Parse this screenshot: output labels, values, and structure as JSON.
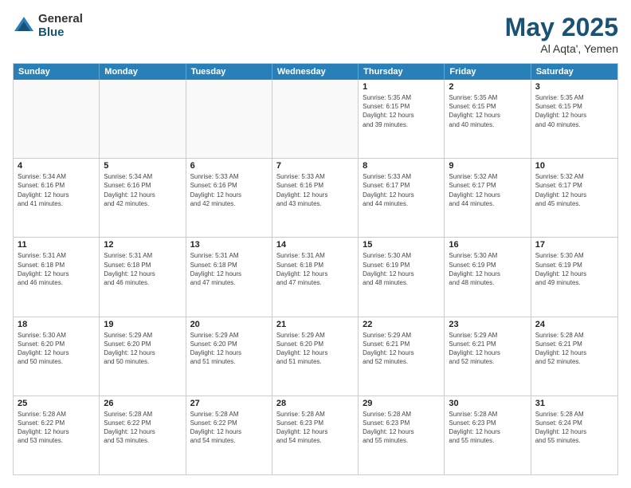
{
  "logo": {
    "general": "General",
    "blue": "Blue"
  },
  "title": {
    "month_year": "May 2025",
    "location": "Al Aqta', Yemen"
  },
  "days_of_week": [
    "Sunday",
    "Monday",
    "Tuesday",
    "Wednesday",
    "Thursday",
    "Friday",
    "Saturday"
  ],
  "weeks": [
    [
      {
        "day": "",
        "info": ""
      },
      {
        "day": "",
        "info": ""
      },
      {
        "day": "",
        "info": ""
      },
      {
        "day": "",
        "info": ""
      },
      {
        "day": "1",
        "info": "Sunrise: 5:35 AM\nSunset: 6:15 PM\nDaylight: 12 hours\nand 39 minutes."
      },
      {
        "day": "2",
        "info": "Sunrise: 5:35 AM\nSunset: 6:15 PM\nDaylight: 12 hours\nand 40 minutes."
      },
      {
        "day": "3",
        "info": "Sunrise: 5:35 AM\nSunset: 6:15 PM\nDaylight: 12 hours\nand 40 minutes."
      }
    ],
    [
      {
        "day": "4",
        "info": "Sunrise: 5:34 AM\nSunset: 6:16 PM\nDaylight: 12 hours\nand 41 minutes."
      },
      {
        "day": "5",
        "info": "Sunrise: 5:34 AM\nSunset: 6:16 PM\nDaylight: 12 hours\nand 42 minutes."
      },
      {
        "day": "6",
        "info": "Sunrise: 5:33 AM\nSunset: 6:16 PM\nDaylight: 12 hours\nand 42 minutes."
      },
      {
        "day": "7",
        "info": "Sunrise: 5:33 AM\nSunset: 6:16 PM\nDaylight: 12 hours\nand 43 minutes."
      },
      {
        "day": "8",
        "info": "Sunrise: 5:33 AM\nSunset: 6:17 PM\nDaylight: 12 hours\nand 44 minutes."
      },
      {
        "day": "9",
        "info": "Sunrise: 5:32 AM\nSunset: 6:17 PM\nDaylight: 12 hours\nand 44 minutes."
      },
      {
        "day": "10",
        "info": "Sunrise: 5:32 AM\nSunset: 6:17 PM\nDaylight: 12 hours\nand 45 minutes."
      }
    ],
    [
      {
        "day": "11",
        "info": "Sunrise: 5:31 AM\nSunset: 6:18 PM\nDaylight: 12 hours\nand 46 minutes."
      },
      {
        "day": "12",
        "info": "Sunrise: 5:31 AM\nSunset: 6:18 PM\nDaylight: 12 hours\nand 46 minutes."
      },
      {
        "day": "13",
        "info": "Sunrise: 5:31 AM\nSunset: 6:18 PM\nDaylight: 12 hours\nand 47 minutes."
      },
      {
        "day": "14",
        "info": "Sunrise: 5:31 AM\nSunset: 6:18 PM\nDaylight: 12 hours\nand 47 minutes."
      },
      {
        "day": "15",
        "info": "Sunrise: 5:30 AM\nSunset: 6:19 PM\nDaylight: 12 hours\nand 48 minutes."
      },
      {
        "day": "16",
        "info": "Sunrise: 5:30 AM\nSunset: 6:19 PM\nDaylight: 12 hours\nand 48 minutes."
      },
      {
        "day": "17",
        "info": "Sunrise: 5:30 AM\nSunset: 6:19 PM\nDaylight: 12 hours\nand 49 minutes."
      }
    ],
    [
      {
        "day": "18",
        "info": "Sunrise: 5:30 AM\nSunset: 6:20 PM\nDaylight: 12 hours\nand 50 minutes."
      },
      {
        "day": "19",
        "info": "Sunrise: 5:29 AM\nSunset: 6:20 PM\nDaylight: 12 hours\nand 50 minutes."
      },
      {
        "day": "20",
        "info": "Sunrise: 5:29 AM\nSunset: 6:20 PM\nDaylight: 12 hours\nand 51 minutes."
      },
      {
        "day": "21",
        "info": "Sunrise: 5:29 AM\nSunset: 6:20 PM\nDaylight: 12 hours\nand 51 minutes."
      },
      {
        "day": "22",
        "info": "Sunrise: 5:29 AM\nSunset: 6:21 PM\nDaylight: 12 hours\nand 52 minutes."
      },
      {
        "day": "23",
        "info": "Sunrise: 5:29 AM\nSunset: 6:21 PM\nDaylight: 12 hours\nand 52 minutes."
      },
      {
        "day": "24",
        "info": "Sunrise: 5:28 AM\nSunset: 6:21 PM\nDaylight: 12 hours\nand 52 minutes."
      }
    ],
    [
      {
        "day": "25",
        "info": "Sunrise: 5:28 AM\nSunset: 6:22 PM\nDaylight: 12 hours\nand 53 minutes."
      },
      {
        "day": "26",
        "info": "Sunrise: 5:28 AM\nSunset: 6:22 PM\nDaylight: 12 hours\nand 53 minutes."
      },
      {
        "day": "27",
        "info": "Sunrise: 5:28 AM\nSunset: 6:22 PM\nDaylight: 12 hours\nand 54 minutes."
      },
      {
        "day": "28",
        "info": "Sunrise: 5:28 AM\nSunset: 6:23 PM\nDaylight: 12 hours\nand 54 minutes."
      },
      {
        "day": "29",
        "info": "Sunrise: 5:28 AM\nSunset: 6:23 PM\nDaylight: 12 hours\nand 55 minutes."
      },
      {
        "day": "30",
        "info": "Sunrise: 5:28 AM\nSunset: 6:23 PM\nDaylight: 12 hours\nand 55 minutes."
      },
      {
        "day": "31",
        "info": "Sunrise: 5:28 AM\nSunset: 6:24 PM\nDaylight: 12 hours\nand 55 minutes."
      }
    ]
  ]
}
